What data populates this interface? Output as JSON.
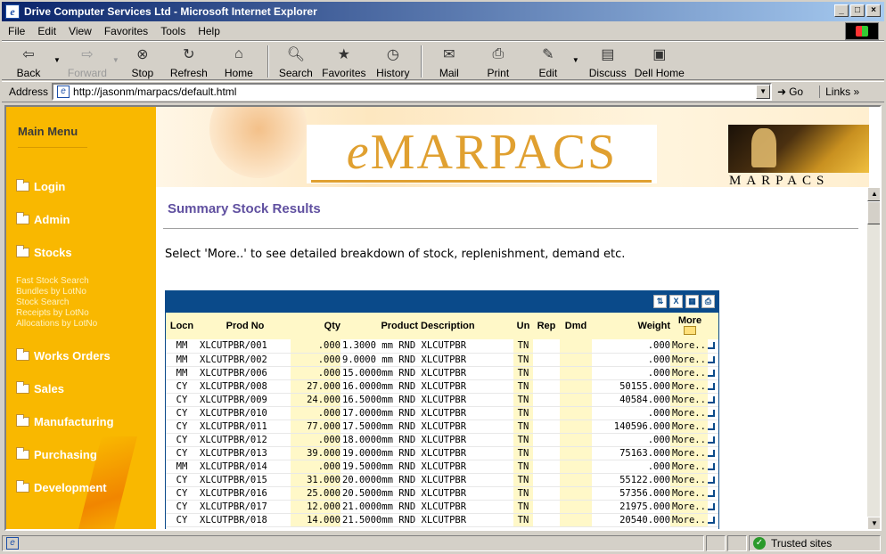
{
  "window": {
    "title": "Drive Computer Services Ltd - Microsoft Internet Explorer"
  },
  "menubar": {
    "items": [
      "File",
      "Edit",
      "View",
      "Favorites",
      "Tools",
      "Help"
    ]
  },
  "toolbar": {
    "back": "Back",
    "forward": "Forward",
    "stop": "Stop",
    "refresh": "Refresh",
    "home": "Home",
    "search": "Search",
    "favorites": "Favorites",
    "history": "History",
    "mail": "Mail",
    "print": "Print",
    "edit": "Edit",
    "discuss": "Discuss",
    "dell_home": "Dell Home"
  },
  "address": {
    "label": "Address",
    "url": "http://jasonm/marpacs/default.html",
    "go": "Go",
    "links": "Links"
  },
  "sidebar": {
    "title": "Main Menu",
    "items": [
      "Login",
      "Admin",
      "Stocks",
      "Works Orders",
      "Sales",
      "Manufacturing",
      "Purchasing",
      "Development"
    ],
    "stock_links": [
      "Fast Stock Search",
      "Bundles by LotNo",
      "Stock Search",
      "Receipts by LotNo",
      "Allocations by LotNo"
    ]
  },
  "header": {
    "banner_e": "e",
    "banner_rest": "MARPACS",
    "logo_text": "MARPACS"
  },
  "main": {
    "title": "Summary Stock Results",
    "instructions": "Select 'More..' to see detailed breakdown of stock, replenishment, demand etc."
  },
  "grid": {
    "columns": [
      "Locn",
      "Prod No",
      "Qty",
      "Product Description",
      "Un",
      "Rep",
      "Dmd",
      "Weight",
      "More"
    ],
    "rows": [
      [
        "MM",
        "XLCUTPBR/001",
        ".000",
        "1.3000 mm RND XLCUTPBR",
        "TN",
        "",
        "",
        ".000",
        "More.."
      ],
      [
        "MM",
        "XLCUTPBR/002",
        ".000",
        "9.0000 mm RND XLCUTPBR",
        "TN",
        "",
        "",
        ".000",
        "More.."
      ],
      [
        "MM",
        "XLCUTPBR/006",
        ".000",
        "15.0000mm RND XLCUTPBR",
        "TN",
        "",
        "",
        ".000",
        "More.."
      ],
      [
        "CY",
        "XLCUTPBR/008",
        "27.000",
        "16.0000mm RND XLCUTPBR",
        "TN",
        "",
        "",
        "50155.000",
        "More.."
      ],
      [
        "CY",
        "XLCUTPBR/009",
        "24.000",
        "16.5000mm RND XLCUTPBR",
        "TN",
        "",
        "",
        "40584.000",
        "More.."
      ],
      [
        "CY",
        "XLCUTPBR/010",
        ".000",
        "17.0000mm RND XLCUTPBR",
        "TN",
        "",
        "",
        ".000",
        "More.."
      ],
      [
        "CY",
        "XLCUTPBR/011",
        "77.000",
        "17.5000mm RND XLCUTPBR",
        "TN",
        "",
        "",
        "140596.000",
        "More.."
      ],
      [
        "CY",
        "XLCUTPBR/012",
        ".000",
        "18.0000mm RND XLCUTPBR",
        "TN",
        "",
        "",
        ".000",
        "More.."
      ],
      [
        "CY",
        "XLCUTPBR/013",
        "39.000",
        "19.0000mm RND XLCUTPBR",
        "TN",
        "",
        "",
        "75163.000",
        "More.."
      ],
      [
        "MM",
        "XLCUTPBR/014",
        ".000",
        "19.5000mm RND XLCUTPBR",
        "TN",
        "",
        "",
        ".000",
        "More.."
      ],
      [
        "CY",
        "XLCUTPBR/015",
        "31.000",
        "20.0000mm RND XLCUTPBR",
        "TN",
        "",
        "",
        "55122.000",
        "More.."
      ],
      [
        "CY",
        "XLCUTPBR/016",
        "25.000",
        "20.5000mm RND XLCUTPBR",
        "TN",
        "",
        "",
        "57356.000",
        "More.."
      ],
      [
        "CY",
        "XLCUTPBR/017",
        "12.000",
        "21.0000mm RND XLCUTPBR",
        "TN",
        "",
        "",
        "21975.000",
        "More.."
      ],
      [
        "CY",
        "XLCUTPBR/018",
        "14.000",
        "21.5000mm RND XLCUTPBR",
        "TN",
        "",
        "",
        "20540.000",
        "More.."
      ]
    ]
  },
  "status": {
    "zone": "Trusted sites"
  }
}
